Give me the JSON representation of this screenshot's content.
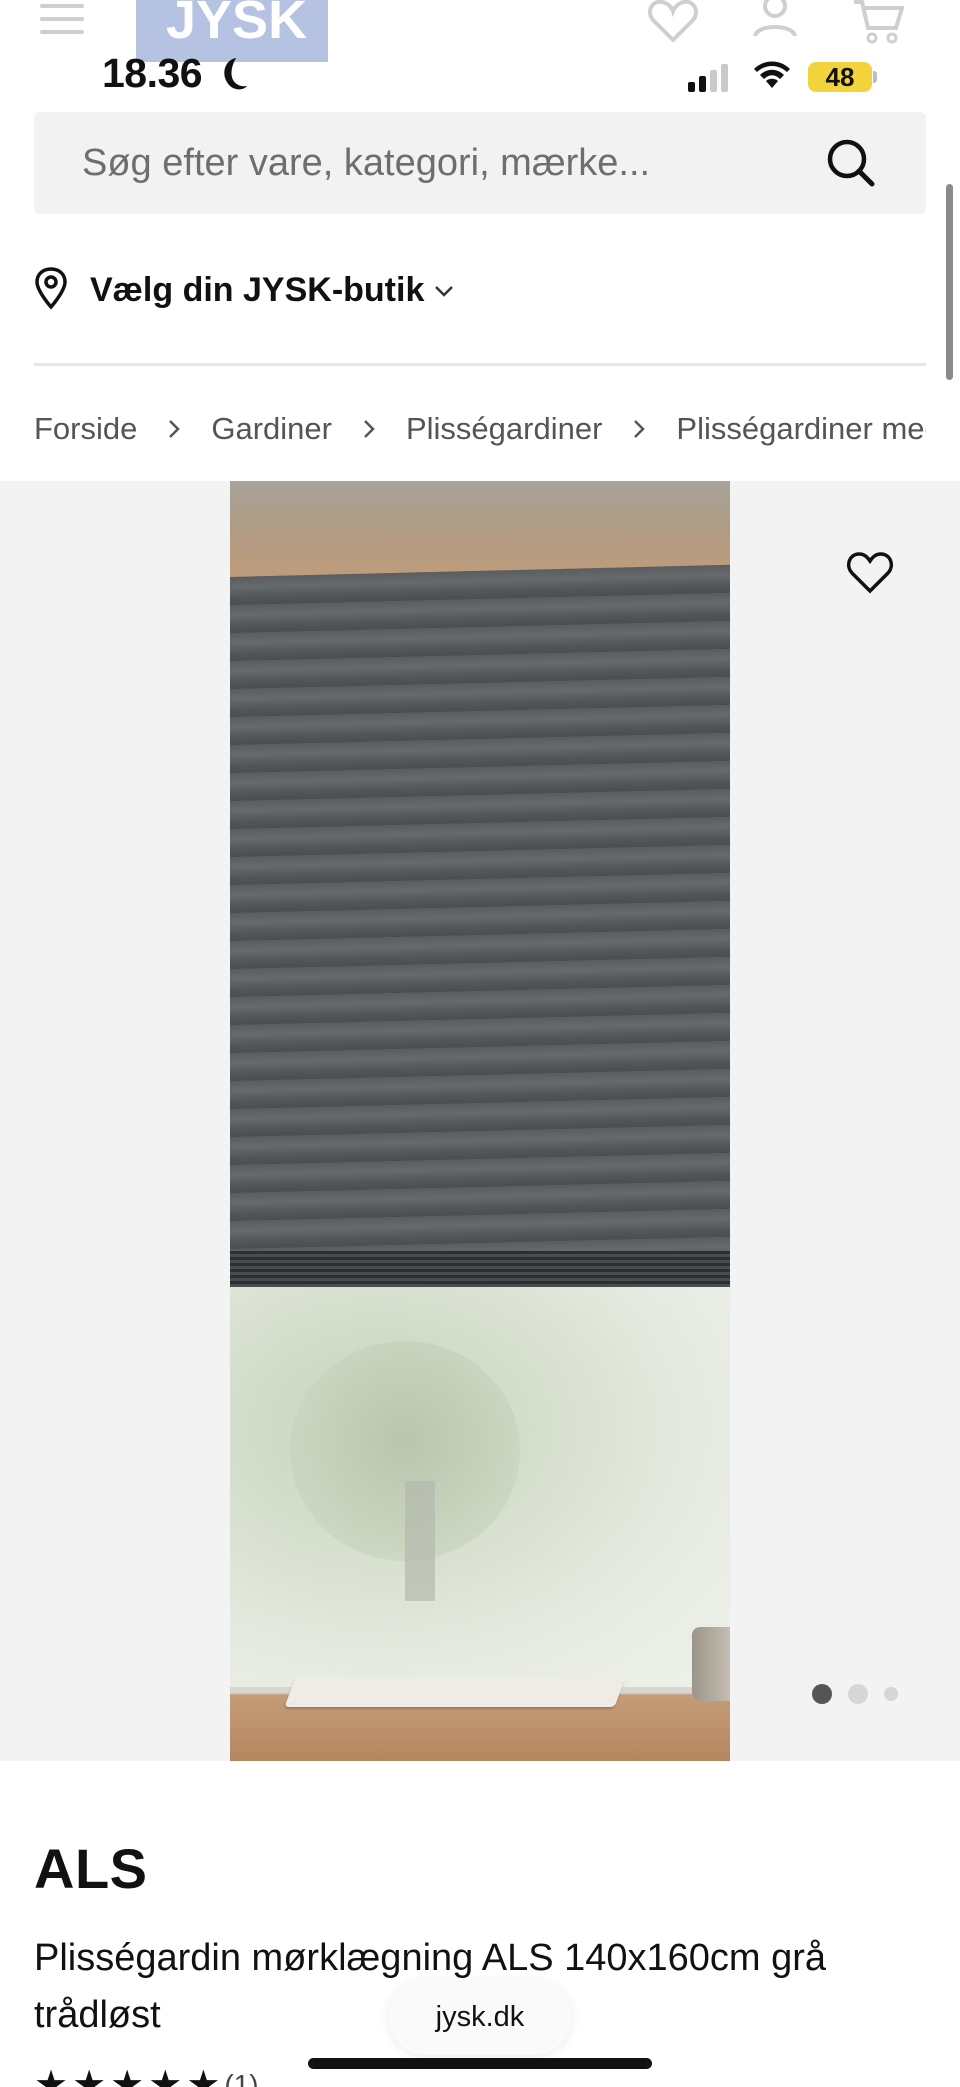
{
  "header": {
    "logo_text": "JYSK",
    "menu_icon": "hamburger-icon",
    "favorites_icon": "heart-icon",
    "account_icon": "user-icon",
    "cart_icon": "cart-icon"
  },
  "status_bar": {
    "time": "18.36",
    "battery": "48",
    "moon_icon": "moon-icon",
    "signal_icon": "cellular-signal-icon",
    "wifi_icon": "wifi-icon"
  },
  "search": {
    "placeholder": "Søg efter vare, kategori, mærke...",
    "value": "",
    "icon": "search-icon"
  },
  "store_selector": {
    "label": "Vælg din JYSK-butik",
    "icon": "location-pin-icon"
  },
  "breadcrumb": {
    "items": [
      "Forside",
      "Gardiner",
      "Plisségardiner",
      "Plisségardiner med mørklægning"
    ]
  },
  "gallery": {
    "image_count": 3,
    "active_index": 0
  },
  "product": {
    "name": "ALS",
    "description": "Plisségardin mørklægning ALS 140x160cm grå trådløst",
    "rating_stars": 5,
    "rating_count": "(1)"
  },
  "browser": {
    "url": "jysk.dk"
  },
  "colors": {
    "accent": "#f3d33c",
    "search_bg": "#f2f2f2",
    "gallery_bg": "#f3f3f3",
    "logo": "#aab8dc"
  }
}
